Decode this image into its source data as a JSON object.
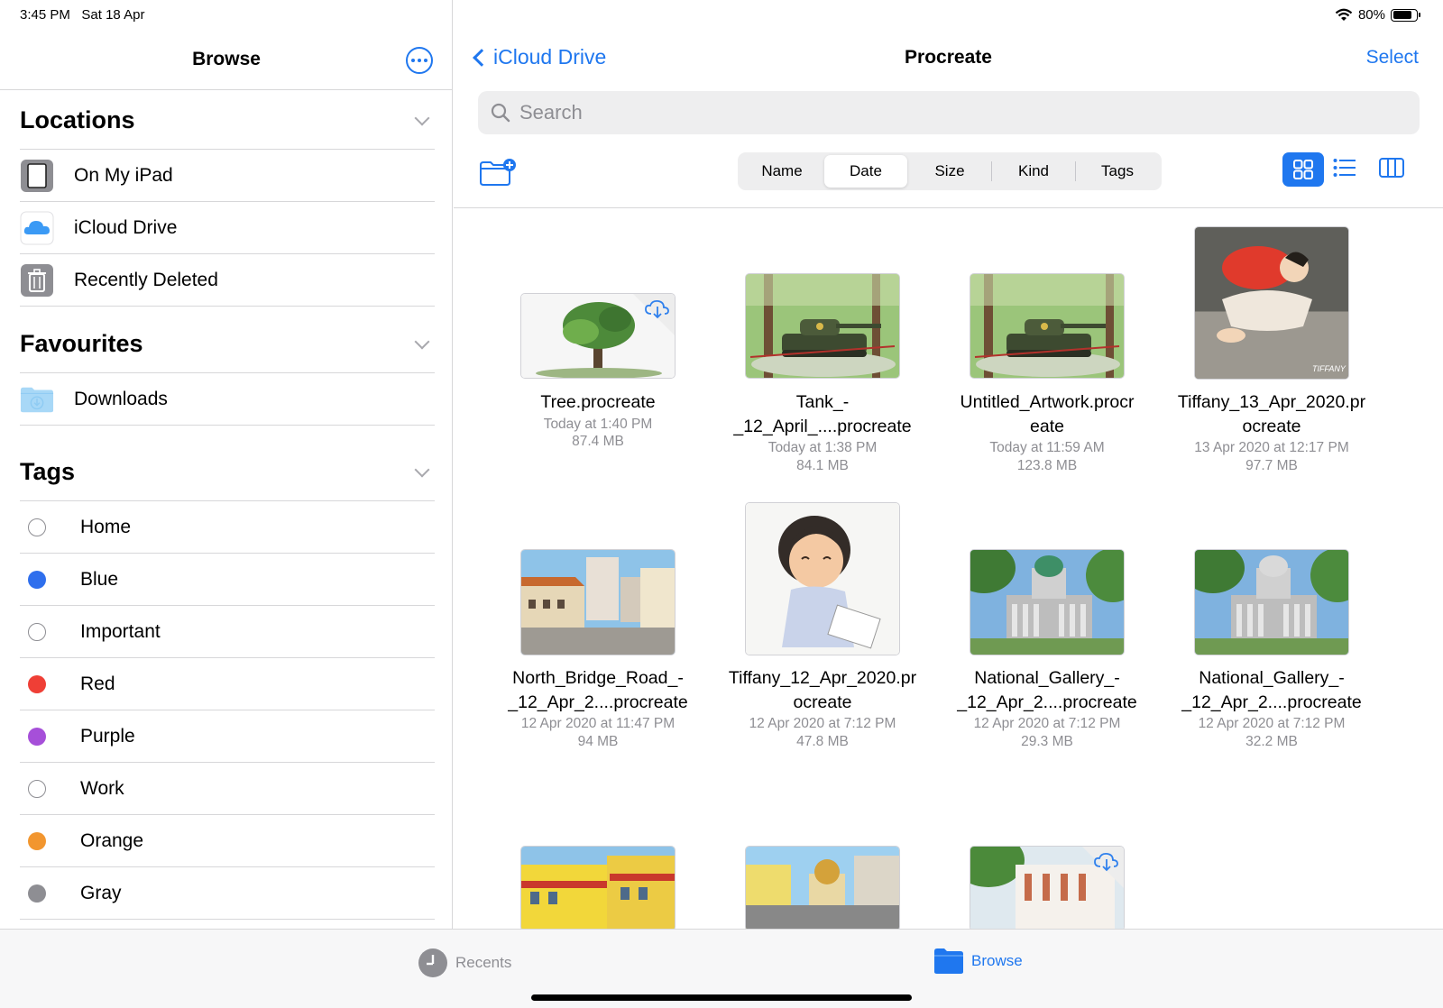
{
  "status": {
    "time": "3:45 PM",
    "date": "Sat 18 Apr",
    "battery": "80%",
    "battery_level": 0.8
  },
  "sidebar": {
    "title": "Browse",
    "locations": {
      "title": "Locations",
      "items": [
        {
          "label": "On My iPad",
          "icon": "ipad-icon"
        },
        {
          "label": "iCloud Drive",
          "icon": "icloud-icon"
        },
        {
          "label": "Recently Deleted",
          "icon": "trash-icon"
        }
      ]
    },
    "favourites": {
      "title": "Favourites",
      "items": [
        {
          "label": "Downloads",
          "icon": "downloads-folder-icon"
        }
      ]
    },
    "tags": {
      "title": "Tags",
      "items": [
        {
          "label": "Home",
          "color": ""
        },
        {
          "label": "Blue",
          "color": "#2f6fed"
        },
        {
          "label": "Important",
          "color": ""
        },
        {
          "label": "Red",
          "color": "#ef3f36"
        },
        {
          "label": "Purple",
          "color": "#a64fd9"
        },
        {
          "label": "Work",
          "color": ""
        },
        {
          "label": "Orange",
          "color": "#f2962f"
        },
        {
          "label": "Gray",
          "color": "#8e8e93"
        }
      ]
    }
  },
  "main": {
    "back_label": "iCloud Drive",
    "title": "Procreate",
    "select_label": "Select",
    "search_placeholder": "Search",
    "sort_options": [
      "Name",
      "Date",
      "Size",
      "Kind",
      "Tags"
    ],
    "active_sort": "Date",
    "files": [
      {
        "name_lines": [
          "Tree.procreate"
        ],
        "date": "Today at 1:40 PM",
        "size": "87.4 MB",
        "cloud": true,
        "art": "tree"
      },
      {
        "name_lines": [
          "Tank_-",
          "_12_April_....procreate"
        ],
        "date": "Today at 1:38 PM",
        "size": "84.1 MB",
        "cloud": false,
        "art": "tank"
      },
      {
        "name_lines": [
          "Untitled_Artwork.procr",
          "eate"
        ],
        "date": "Today at 11:59 AM",
        "size": "123.8 MB",
        "cloud": false,
        "art": "tank2"
      },
      {
        "name_lines": [
          "Tiffany_13_Apr_2020.pr",
          "ocreate"
        ],
        "date": "13 Apr 2020 at 12:17 PM",
        "size": "97.7 MB",
        "cloud": false,
        "art": "sleep"
      },
      {
        "name_lines": [
          "North_Bridge_Road_-",
          "_12_Apr_2....procreate"
        ],
        "date": "12 Apr 2020 at 11:47 PM",
        "size": "94 MB",
        "cloud": false,
        "art": "street"
      },
      {
        "name_lines": [
          "Tiffany_12_Apr_2020.pr",
          "ocreate"
        ],
        "date": "12 Apr 2020 at 7:12 PM",
        "size": "47.8 MB",
        "cloud": false,
        "art": "girl"
      },
      {
        "name_lines": [
          "National_Gallery_-",
          "_12_Apr_2....procreate"
        ],
        "date": "12 Apr 2020 at 7:12 PM",
        "size": "29.3 MB",
        "cloud": false,
        "art": "gallery"
      },
      {
        "name_lines": [
          "National_Gallery_-",
          "_12_Apr_2....procreate"
        ],
        "date": "12 Apr 2020 at 7:12 PM",
        "size": "32.2 MB",
        "cloud": false,
        "art": "gallery2"
      },
      {
        "name_lines": [],
        "date": "",
        "size": "",
        "cloud": false,
        "art": "shophouse"
      },
      {
        "name_lines": [],
        "date": "",
        "size": "",
        "cloud": false,
        "art": "mosque"
      },
      {
        "name_lines": [],
        "date": "",
        "size": "",
        "cloud": true,
        "art": "colonial"
      }
    ]
  },
  "tabbar": {
    "recents_label": "Recents",
    "browse_label": "Browse",
    "active": "Browse"
  }
}
